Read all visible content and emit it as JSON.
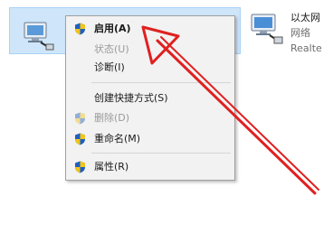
{
  "adapters": [
    {
      "name": "",
      "description": ""
    },
    {
      "name": "以太网",
      "status": "网络",
      "device": "Realte"
    }
  ],
  "menu": {
    "enable": "启用(A)",
    "status": "状态(U)",
    "diagnose": "诊断(I)",
    "create_shortcut": "创建快捷方式(S)",
    "delete": "删除(D)",
    "rename": "重命名(M)",
    "properties": "属性(R)"
  },
  "colors": {
    "selection": "#cfe6fa",
    "menu_background": "#f2f2f2",
    "annotation_arrow": "#e02020",
    "shield_blue": "#1f5fbf",
    "shield_yellow": "#f2c51b"
  },
  "icons": {
    "adapter": "network-adapter-icon",
    "shield": "uac-shield-icon"
  }
}
